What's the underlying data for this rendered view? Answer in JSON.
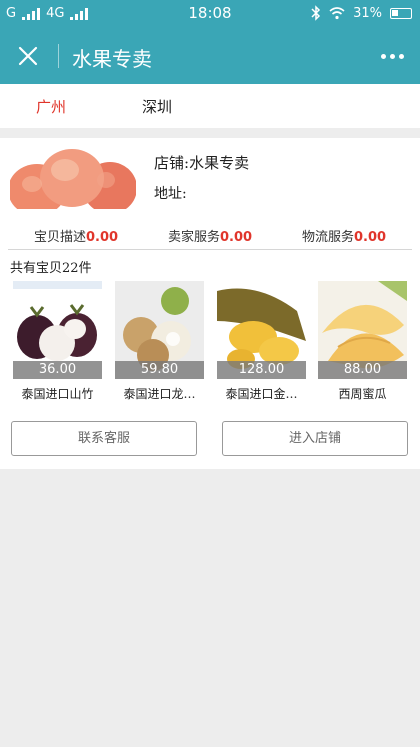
{
  "status_bar": {
    "carrier1": "G",
    "carrier2": "4G",
    "time": "18:08",
    "battery": "31%",
    "icons": [
      "signal-icon",
      "bluetooth-icon",
      "wifi-icon",
      "battery-icon"
    ]
  },
  "header": {
    "title": "水果专卖",
    "close_icon": "close-icon",
    "more_icon": "more-icon",
    "bg_color": "#3aa6b6"
  },
  "city_tabs": [
    {
      "label": "广州",
      "active": true
    },
    {
      "label": "深圳",
      "active": false
    }
  ],
  "shop": {
    "name_label": "店铺:",
    "name_value": "水果专卖",
    "address_label": "地址:",
    "ratings": [
      {
        "label": "宝贝描述",
        "value": "0.00"
      },
      {
        "label": "卖家服务",
        "value": "0.00"
      },
      {
        "label": "物流服务",
        "value": "0.00"
      }
    ],
    "product_count_prefix": "共有宝贝",
    "product_count": "22",
    "product_count_suffix": "件",
    "products": [
      {
        "price": "36.00",
        "name": "泰国进口山竹"
      },
      {
        "price": "59.80",
        "name": "泰国进口龙…"
      },
      {
        "price": "128.00",
        "name": "泰国进口金…"
      },
      {
        "price": "88.00",
        "name": "西周蜜瓜"
      }
    ],
    "contact_button": "联系客服",
    "enter_button": "进入店铺"
  },
  "colors": {
    "accent": "#e0352b",
    "teal": "#3aa6b6"
  }
}
